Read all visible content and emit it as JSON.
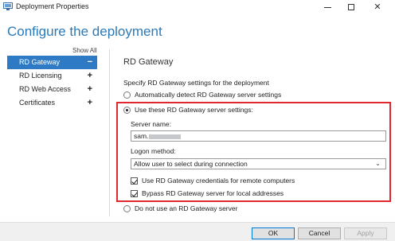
{
  "window": {
    "title": "Deployment Properties",
    "icon": "server-manager-icon"
  },
  "heading": "Configure the deployment",
  "nav": {
    "show_all": "Show All",
    "items": [
      {
        "label": "RD Gateway",
        "sign": "−",
        "selected": true
      },
      {
        "label": "RD Licensing",
        "sign": "+"
      },
      {
        "label": "RD Web Access",
        "sign": "+"
      },
      {
        "label": "Certificates",
        "sign": "+"
      }
    ]
  },
  "gateway": {
    "section_title": "RD Gateway",
    "intro": "Specify RD Gateway settings for the deployment",
    "option_auto": "Automatically detect RD Gateway server settings",
    "option_use": "Use these RD Gateway server settings:",
    "option_none": "Do not use an RD Gateway server",
    "selected_option": "use",
    "server_name_label": "Server name:",
    "server_name_value": "sam.",
    "logon_method_label": "Logon method:",
    "logon_method_value": "Allow user to select during connection",
    "check_credentials": "Use RD Gateway credentials for remote computers",
    "check_credentials_checked": true,
    "check_bypass": "Bypass RD Gateway server for local addresses",
    "check_bypass_checked": true,
    "highlight_color": "#e0262e"
  },
  "buttons": {
    "ok": "OK",
    "cancel": "Cancel",
    "apply": "Apply"
  }
}
